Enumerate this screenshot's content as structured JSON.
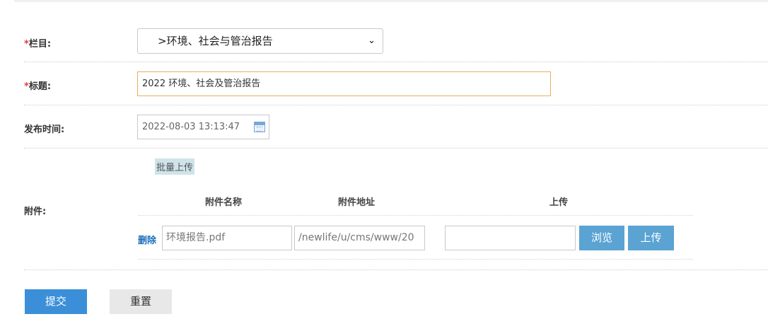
{
  "form": {
    "category": {
      "required_mark": "*",
      "label": "栏目:",
      "selected": ">环境、社会与管治报告",
      "chevron": "⌄"
    },
    "title": {
      "required_mark": "*",
      "label": "标题:",
      "value": "2022 环境、社会及管治报告"
    },
    "publish_time": {
      "label": "发布时间:",
      "value": "2022-08-03 13:13:47"
    },
    "attachments": {
      "label": "附件:",
      "batch_upload": "批量上传",
      "columns": {
        "name": "附件名称",
        "address": "附件地址",
        "upload": "上传"
      },
      "rows": [
        {
          "delete": "删除",
          "name": "环境报告.pdf",
          "address": "/newlife/u/cms/www/20",
          "file_path": "",
          "browse": "浏览",
          "upload": "上传"
        }
      ]
    },
    "actions": {
      "submit": "提交",
      "reset": "重置"
    }
  }
}
